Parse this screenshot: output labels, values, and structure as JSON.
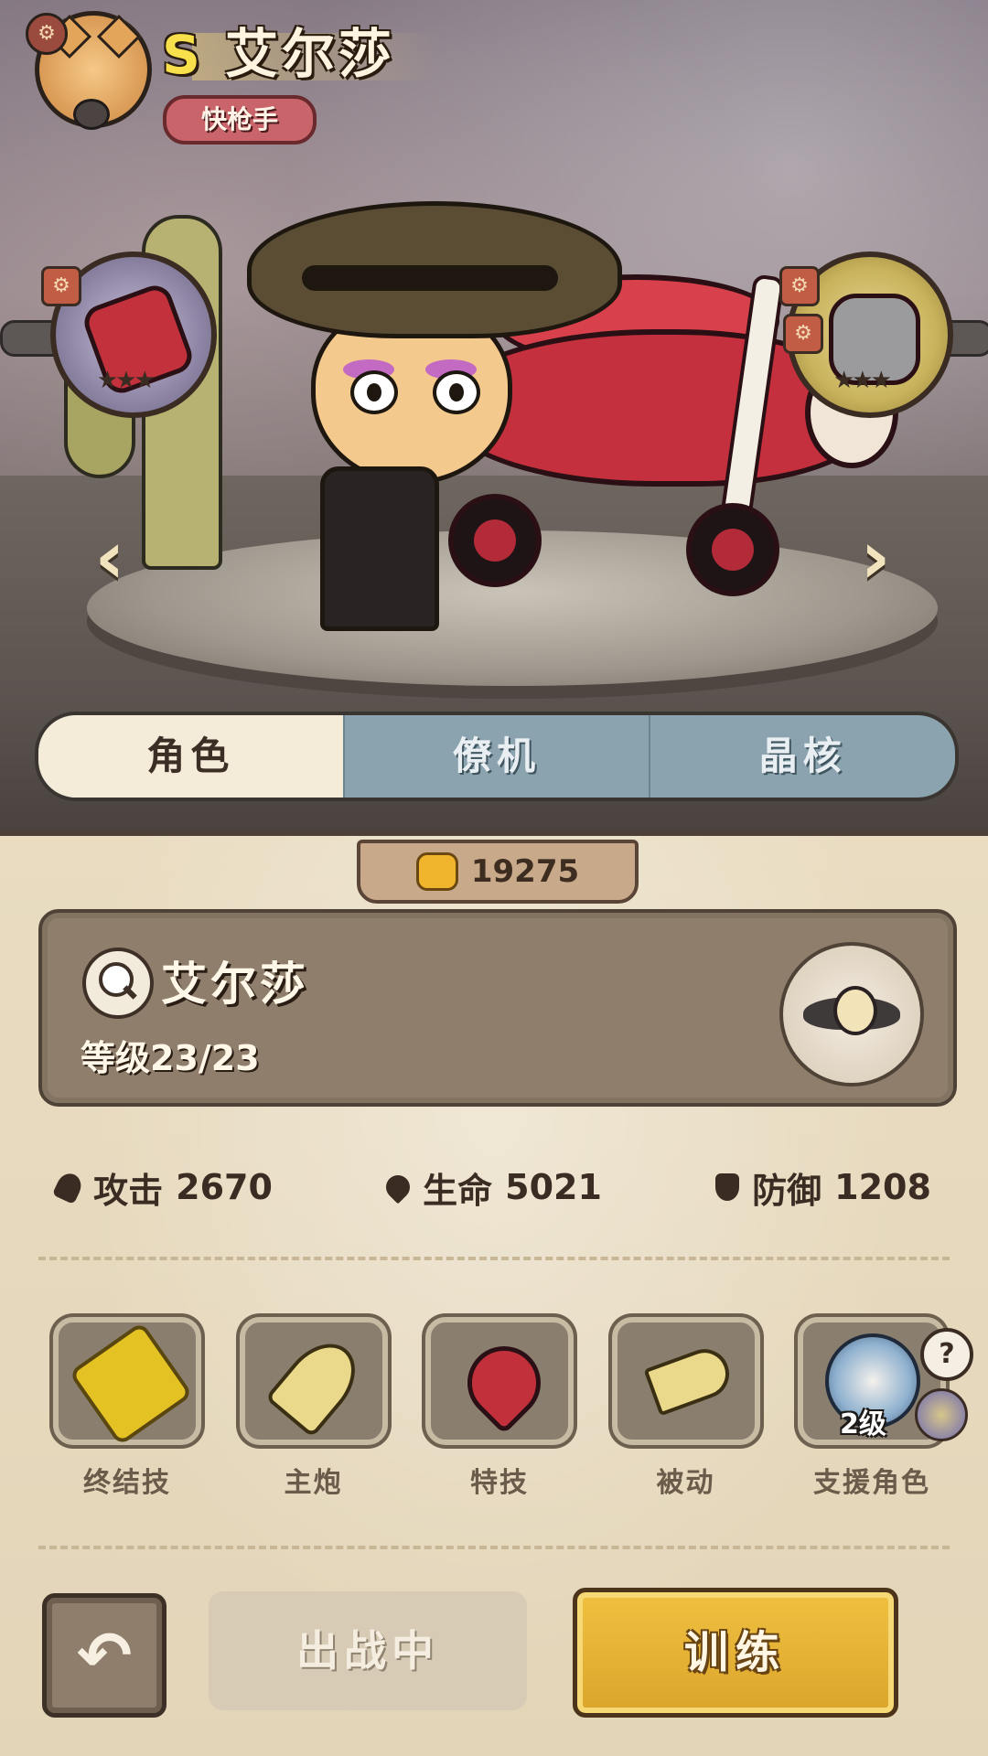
{
  "header": {
    "rank": "S",
    "name": "艾尔莎",
    "class_tag": "快枪手"
  },
  "scene": {
    "left_arrow": "‹",
    "right_arrow": "›",
    "left_badge_icon": "cannon-icon",
    "right_badge_icon": "gatling-icon"
  },
  "tabs": [
    {
      "label": "角色",
      "active": true
    },
    {
      "label": "僚机",
      "active": false
    },
    {
      "label": "晶核",
      "active": false
    }
  ],
  "power": {
    "icon": "fist-icon",
    "value": "19275"
  },
  "info_card": {
    "name": "艾尔莎",
    "level": "等级23/23"
  },
  "stats": {
    "attack_label": "攻击",
    "attack_value": "2670",
    "hp_label": "生命",
    "hp_value": "5021",
    "defense_label": "防御",
    "defense_value": "1208"
  },
  "skills": [
    {
      "label": "终结技",
      "icon": "gatling-gun-icon"
    },
    {
      "label": "主炮",
      "icon": "bullet-icon"
    },
    {
      "label": "特技",
      "icon": "heart-icon"
    },
    {
      "label": "被动",
      "icon": "double-bullet-icon"
    },
    {
      "label": "支援角色",
      "icon": "support-character-icon",
      "level": "2级"
    }
  ],
  "actions": {
    "back_glyph": "↶",
    "deploy_label": "出战中",
    "train_label": "训练"
  },
  "colors": {
    "accent_yellow": "#f0c040",
    "tab_active": "#f4ecd9",
    "tab_inactive": "#8ba3ae",
    "panel_bg": "#e9dcc1"
  }
}
